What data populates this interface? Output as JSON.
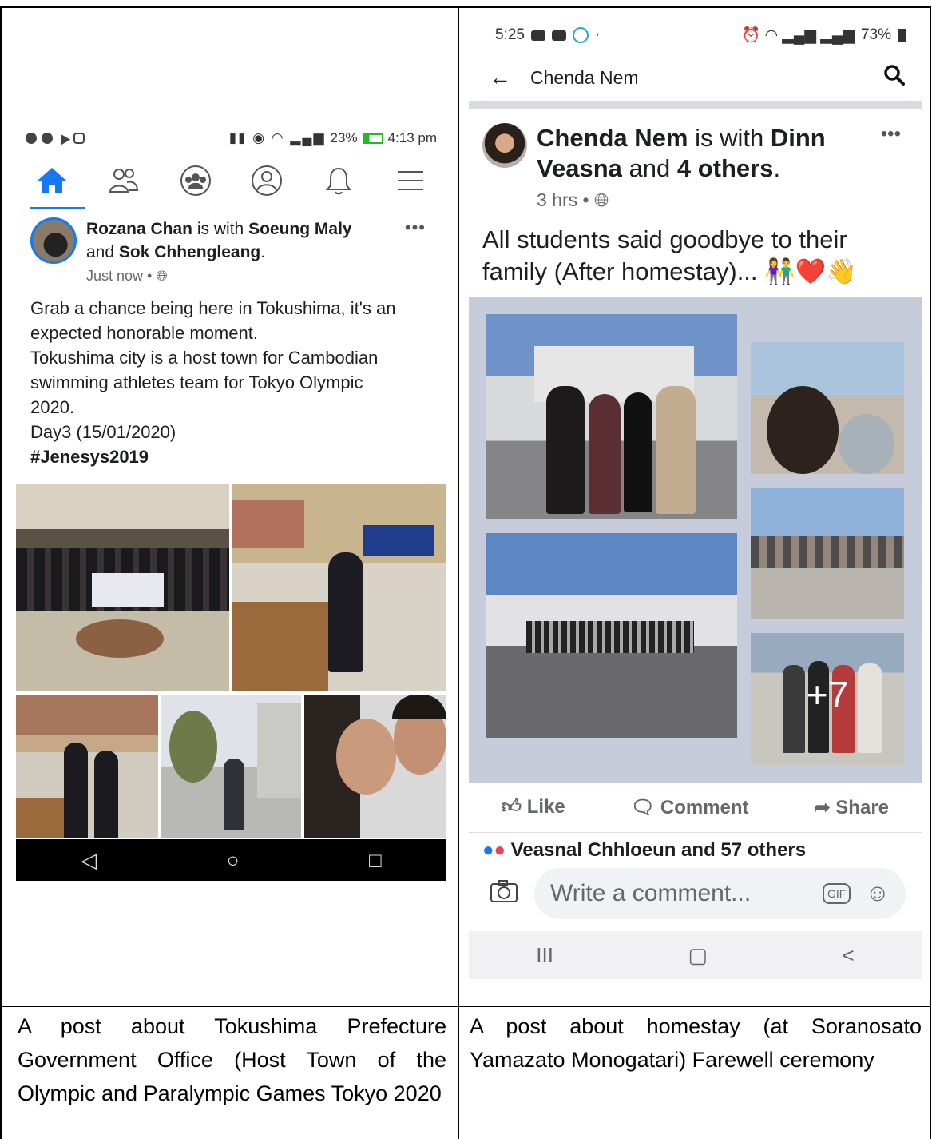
{
  "left": {
    "status": {
      "time": "4:13 pm",
      "battery": "23%"
    },
    "post": {
      "author": "Rozana Chan",
      "with_word": "is with",
      "tag1": "Soeung Maly",
      "and_word": "and",
      "tag2": "Sok Chhengleang",
      "time": "Just now",
      "more": "•••",
      "lines": [
        "Grab a chance being here in Tokushima, it's an",
        "expected honorable moment.",
        "Tokushima city is a host town for Cambodian",
        "swimming athletes team for Tokyo Olympic",
        "2020.",
        "Day3 (15/01/2020)"
      ],
      "hashtag": "#Jenesys2019"
    },
    "nav": {
      "back": "◁",
      "home": "○",
      "recent": "□"
    },
    "caption": "A post about Tokushima Prefecture Government Office (Host Town of the Olympic and Paralympic Games Tokyo 2020"
  },
  "right": {
    "status": {
      "time": "5:25",
      "battery": "73%"
    },
    "header": {
      "title": "Chenda Nem"
    },
    "post": {
      "author": "Chenda Nem",
      "with_word": "is with",
      "tag1": "Dinn Veasna",
      "and_word": "and",
      "tag2": "4 others",
      "time": "3 hrs",
      "more": "•••",
      "text": "All students said  goodbye to their family (After homestay)...",
      "emoji": "👫❤️👋",
      "more_photos": "+7"
    },
    "actions": {
      "like": "Like",
      "comment": "Comment",
      "share": "Share"
    },
    "reactions": "Veasnal Chhloeun and 57 others",
    "comment": {
      "placeholder": "Write a comment...",
      "gif": "GIF"
    },
    "nav": {
      "recent": "III",
      "home": "▢",
      "back": "<"
    },
    "caption": "A post about homestay (at Soranosato Yamazato Monogatari) Farewell ceremony"
  }
}
